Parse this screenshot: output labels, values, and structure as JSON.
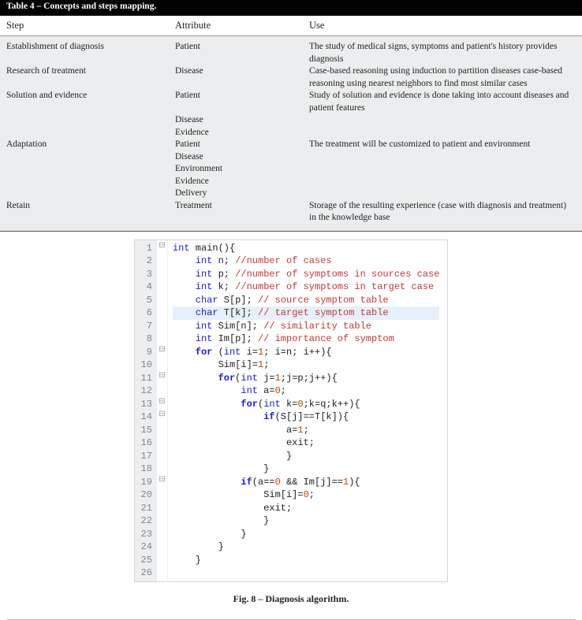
{
  "table": {
    "caption": "Table 4 – Concepts and steps mapping.",
    "headers": {
      "step": "Step",
      "attr": "Attribute",
      "use": "Use"
    },
    "rows": [
      {
        "step": "Establishment of diagnosis",
        "attrs": [
          "Patient"
        ],
        "use": "The study of medical signs, symptoms and patient's history provides diagnosis"
      },
      {
        "step": "Research of treatment",
        "attrs": [
          "Disease"
        ],
        "use": "Case-based reasoning using induction to partition diseases case-based reasoning using nearest neighbors to find most similar cases"
      },
      {
        "step": "Solution and evidence",
        "attrs": [
          "Patient",
          "Disease",
          "Evidence"
        ],
        "use": "Study of solution and evidence is done taking into account diseases and patient features"
      },
      {
        "step": "Adaptation",
        "attrs": [
          "Patient",
          "Disease",
          "Environment",
          "Evidence",
          "Delivery"
        ],
        "use": "The treatment will be customized to patient and environment"
      },
      {
        "step": "Retain",
        "attrs": [
          "Treatment"
        ],
        "use": "Storage of the resulting experience (case with diagnosis and treatment) in the knowledge base"
      }
    ]
  },
  "figure_caption": "Fig. 8 – Diagnosis algorithm.",
  "code": {
    "lines": [
      {
        "n": 1,
        "fold": "⊟",
        "tokens": [
          [
            "ty",
            "int"
          ],
          [
            "",
            " main(){"
          ]
        ]
      },
      {
        "n": 2,
        "fold": "",
        "indent": 1,
        "tokens": [
          [
            "ty",
            "int"
          ],
          [
            "",
            " n; "
          ],
          [
            "cm",
            "//number of cases"
          ]
        ]
      },
      {
        "n": 3,
        "fold": "",
        "indent": 1,
        "tokens": [
          [
            "ty",
            "int"
          ],
          [
            "",
            " p; "
          ],
          [
            "cm",
            "//number of symptoms in sources case"
          ]
        ]
      },
      {
        "n": 4,
        "fold": "",
        "indent": 1,
        "tokens": [
          [
            "ty",
            "int"
          ],
          [
            "",
            " k; "
          ],
          [
            "cm",
            "//number of symptoms in target case"
          ]
        ]
      },
      {
        "n": 5,
        "fold": "",
        "indent": 1,
        "tokens": [
          [
            "ty",
            "char"
          ],
          [
            "",
            " S[p]; "
          ],
          [
            "cm",
            "// source symptom table"
          ]
        ]
      },
      {
        "n": 6,
        "fold": "",
        "indent": 1,
        "hl": true,
        "tokens": [
          [
            "ty",
            "char"
          ],
          [
            "",
            " T[k]; "
          ],
          [
            "cm",
            "// target symptom table"
          ]
        ]
      },
      {
        "n": 7,
        "fold": "",
        "indent": 1,
        "tokens": [
          [
            "ty",
            "int"
          ],
          [
            "",
            " Sim[n]; "
          ],
          [
            "cm",
            "// similarity table"
          ]
        ]
      },
      {
        "n": 8,
        "fold": "",
        "indent": 1,
        "tokens": [
          [
            "ty",
            "int"
          ],
          [
            "",
            " Im[p]; "
          ],
          [
            "cm",
            "// importance of symptom"
          ]
        ]
      },
      {
        "n": 9,
        "fold": "⊟",
        "indent": 1,
        "tokens": [
          [
            "kw",
            "for"
          ],
          [
            "",
            " ("
          ],
          [
            "ty",
            "int"
          ],
          [
            "",
            " i="
          ],
          [
            "num",
            "1"
          ],
          [
            "",
            "; i="
          ],
          [
            "",
            "n; i++){"
          ]
        ]
      },
      {
        "n": 10,
        "fold": "",
        "indent": 2,
        "tokens": [
          [
            "",
            "Sim[i]="
          ],
          [
            "num",
            "1"
          ],
          [
            "",
            ";"
          ]
        ]
      },
      {
        "n": 11,
        "fold": "⊟",
        "indent": 2,
        "tokens": [
          [
            "kw",
            "for"
          ],
          [
            "",
            "("
          ],
          [
            "ty",
            "int"
          ],
          [
            "",
            " j="
          ],
          [
            "num",
            "1"
          ],
          [
            "",
            ";j=p;j++){"
          ]
        ]
      },
      {
        "n": 12,
        "fold": "",
        "indent": 3,
        "tokens": [
          [
            "ty",
            "int"
          ],
          [
            "",
            " a="
          ],
          [
            "num",
            "0"
          ],
          [
            "",
            ";"
          ]
        ]
      },
      {
        "n": 13,
        "fold": "⊟",
        "indent": 3,
        "tokens": [
          [
            "kw",
            "for"
          ],
          [
            "",
            "("
          ],
          [
            "ty",
            "int"
          ],
          [
            "",
            " k="
          ],
          [
            "num",
            "0"
          ],
          [
            "",
            ";k=q;k++){"
          ]
        ]
      },
      {
        "n": 14,
        "fold": "⊟",
        "indent": 4,
        "tokens": [
          [
            "kw",
            "if"
          ],
          [
            "",
            "(S[j]==T[k]){"
          ]
        ]
      },
      {
        "n": 15,
        "fold": "",
        "indent": 5,
        "tokens": [
          [
            "",
            "a="
          ],
          [
            "num",
            "1"
          ],
          [
            "",
            ";"
          ]
        ]
      },
      {
        "n": 16,
        "fold": "",
        "indent": 5,
        "tokens": [
          [
            "",
            "exit;"
          ]
        ]
      },
      {
        "n": 17,
        "fold": "",
        "indent": 5,
        "tokens": [
          [
            "",
            "}"
          ]
        ]
      },
      {
        "n": 18,
        "fold": "",
        "indent": 4,
        "tokens": [
          [
            "",
            "}"
          ]
        ]
      },
      {
        "n": 19,
        "fold": "⊟",
        "indent": 3,
        "tokens": [
          [
            "kw",
            "if"
          ],
          [
            "",
            "(a=="
          ],
          [
            "num",
            "0"
          ],
          [
            "",
            " && Im[j]=="
          ],
          [
            "num",
            "1"
          ],
          [
            "",
            "){"
          ]
        ]
      },
      {
        "n": 20,
        "fold": "",
        "indent": 4,
        "tokens": [
          [
            "",
            "Sim[i]="
          ],
          [
            "num",
            "0"
          ],
          [
            "",
            ";"
          ]
        ]
      },
      {
        "n": 21,
        "fold": "",
        "indent": 4,
        "tokens": [
          [
            "",
            "exit;"
          ]
        ]
      },
      {
        "n": 22,
        "fold": "",
        "indent": 4,
        "tokens": [
          [
            "",
            "}"
          ]
        ]
      },
      {
        "n": 23,
        "fold": "",
        "indent": 3,
        "tokens": [
          [
            "",
            "}"
          ]
        ]
      },
      {
        "n": 24,
        "fold": "",
        "indent": 2,
        "tokens": [
          [
            "",
            "}"
          ]
        ]
      },
      {
        "n": 25,
        "fold": "",
        "indent": 1,
        "tokens": [
          [
            "",
            "}"
          ]
        ]
      },
      {
        "n": 26,
        "fold": "",
        "indent": 0,
        "tokens": [
          [
            "",
            ""
          ]
        ]
      }
    ]
  }
}
